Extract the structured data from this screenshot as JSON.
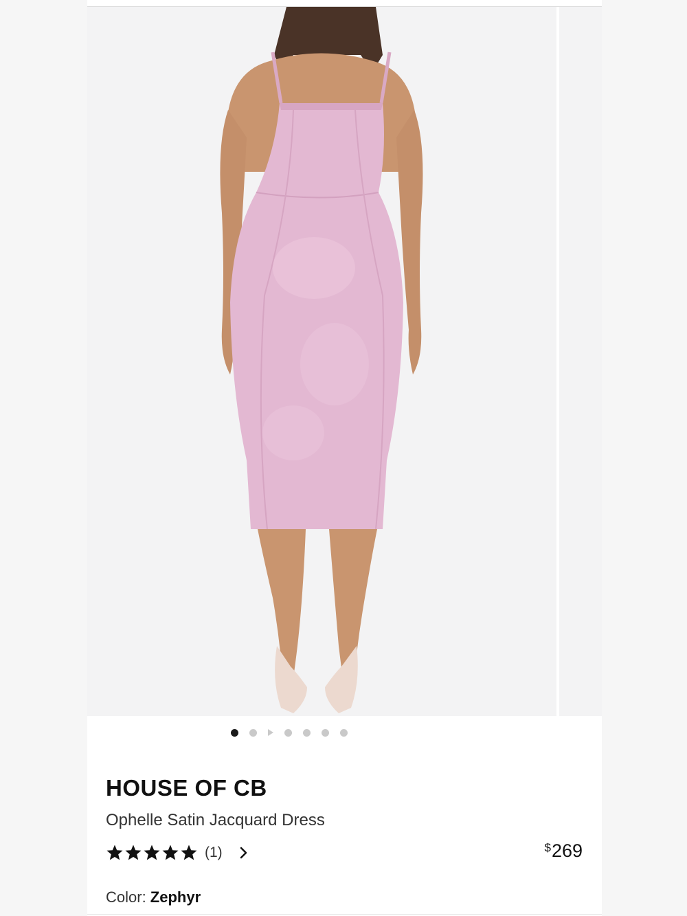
{
  "gallery": {
    "dot_count": 7,
    "active_index": 0,
    "video_index": 2
  },
  "product": {
    "brand": "HOUSE OF CB",
    "name": "Ophelle Satin Jacquard Dress",
    "rating_stars": 5,
    "review_count": "(1)",
    "price_symbol": "$",
    "price_value": "269",
    "color_label": "Color: ",
    "color_value": "Zephyr"
  },
  "colors": {
    "dress": "#e3b8d2",
    "background": "#f3f3f4",
    "text": "#111111",
    "dot_active": "#1a1a1a",
    "dot_inactive": "#c9c9c9"
  },
  "icons": {
    "star": "star-icon",
    "chevron": "chevron-right-icon",
    "play": "play-icon"
  }
}
